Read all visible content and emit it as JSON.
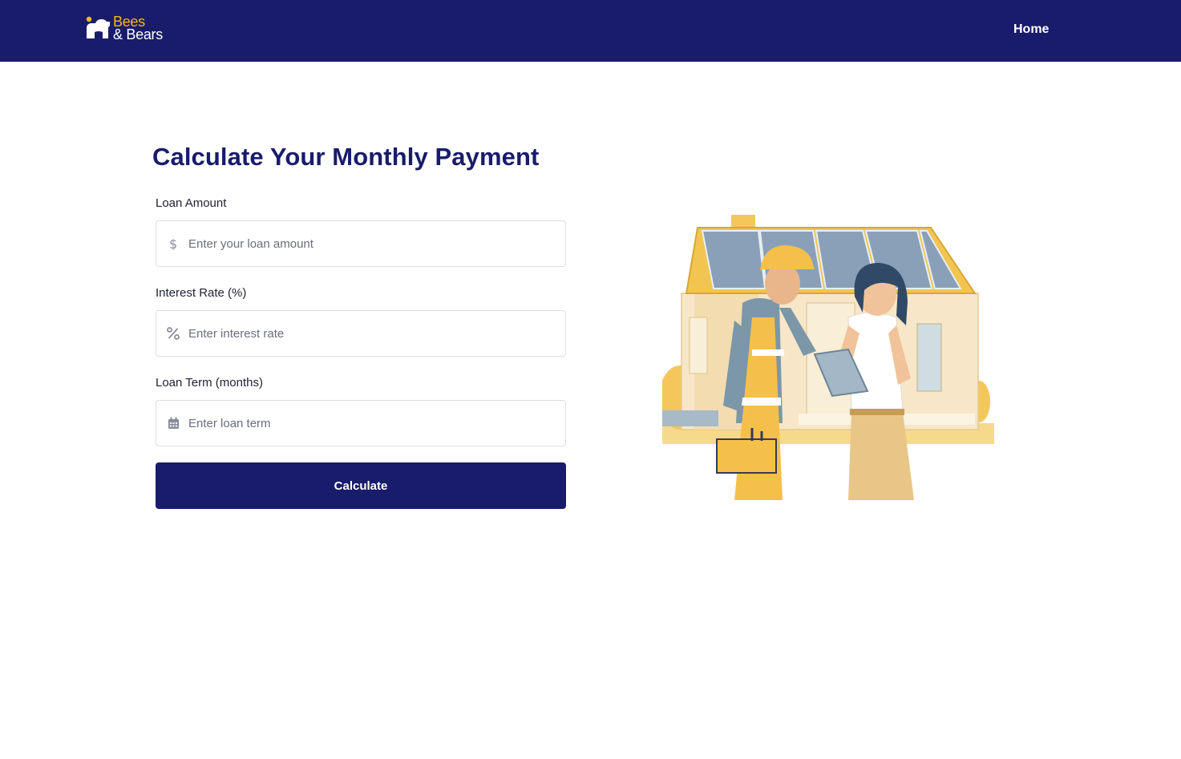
{
  "header": {
    "logo": {
      "line1": "Bees",
      "line2": "& Bears"
    },
    "nav": {
      "home_label": "Home"
    }
  },
  "main": {
    "title": "Calculate Your Monthly Payment",
    "fields": [
      {
        "label": "Loan Amount",
        "placeholder": "Enter your loan amount",
        "icon": "dollar-icon"
      },
      {
        "label": "Interest Rate (%)",
        "placeholder": "Enter interest rate",
        "icon": "percent-icon"
      },
      {
        "label": "Loan Term (months)",
        "placeholder": "Enter loan term",
        "icon": "calendar-icon"
      }
    ],
    "submit_label": "Calculate"
  },
  "colors": {
    "brand_navy": "#191c6b",
    "brand_yellow": "#f5b915"
  }
}
